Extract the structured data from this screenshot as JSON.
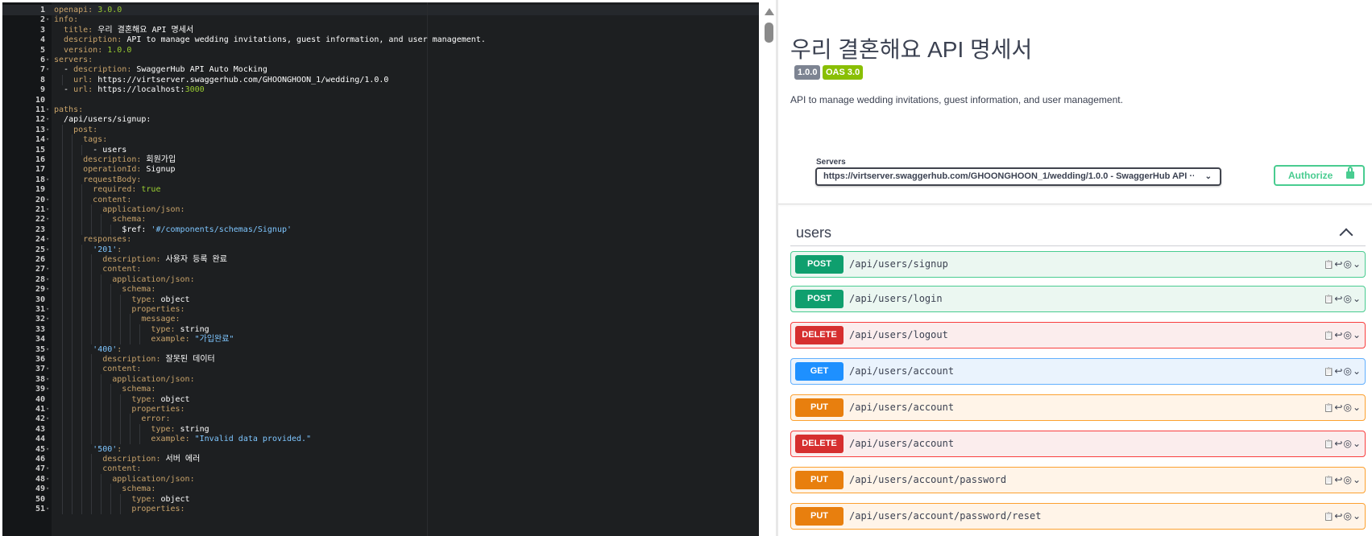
{
  "editor": {
    "lines": [
      [
        "1",
        [
          [
            "k",
            "openapi: "
          ],
          [
            "n",
            "3.0.0"
          ]
        ]
      ],
      [
        "2",
        [
          [
            "k",
            "info:"
          ]
        ]
      ],
      [
        "3",
        [
          [
            "p",
            "  "
          ],
          [
            "k",
            "title: "
          ],
          [
            "s",
            "우리 결혼해요 API 명세서"
          ]
        ]
      ],
      [
        "4",
        [
          [
            "p",
            "  "
          ],
          [
            "k",
            "description: "
          ],
          [
            "s",
            "API to manage wedding invitations, guest information, and user management."
          ]
        ]
      ],
      [
        "5",
        [
          [
            "p",
            "  "
          ],
          [
            "k",
            "version: "
          ],
          [
            "n",
            "1.0.0"
          ]
        ]
      ],
      [
        "6",
        [
          [
            "k",
            "servers:"
          ]
        ]
      ],
      [
        "7",
        [
          [
            "p",
            "  - "
          ],
          [
            "k",
            "description: "
          ],
          [
            "s",
            "SwaggerHub API Auto Mocking"
          ]
        ]
      ],
      [
        "8",
        [
          [
            "p",
            "    "
          ],
          [
            "k",
            "url: "
          ],
          [
            "s",
            "https://virtserver.swaggerhub.com/GHOONGHOON_1/wedding/1.0.0"
          ]
        ]
      ],
      [
        "9",
        [
          [
            "p",
            "  - "
          ],
          [
            "k",
            "url: "
          ],
          [
            "s",
            "https://localhost:"
          ],
          [
            "n",
            "3000"
          ]
        ]
      ],
      [
        "10",
        []
      ],
      [
        "11",
        [
          [
            "k",
            "paths:"
          ]
        ]
      ],
      [
        "12",
        [
          [
            "p",
            "  "
          ],
          [
            "s",
            "/api/users/signup:"
          ]
        ]
      ],
      [
        "13",
        [
          [
            "p",
            "    "
          ],
          [
            "k",
            "post:"
          ]
        ]
      ],
      [
        "14",
        [
          [
            "p",
            "      "
          ],
          [
            "k",
            "tags:"
          ]
        ]
      ],
      [
        "15",
        [
          [
            "p",
            "        - "
          ],
          [
            "s",
            "users"
          ]
        ]
      ],
      [
        "16",
        [
          [
            "p",
            "      "
          ],
          [
            "k",
            "description: "
          ],
          [
            "s",
            "회원가입"
          ]
        ]
      ],
      [
        "17",
        [
          [
            "p",
            "      "
          ],
          [
            "k",
            "operationId: "
          ],
          [
            "s",
            "Signup"
          ]
        ]
      ],
      [
        "18",
        [
          [
            "p",
            "      "
          ],
          [
            "k",
            "requestBody:"
          ]
        ]
      ],
      [
        "19",
        [
          [
            "p",
            "        "
          ],
          [
            "k",
            "required: "
          ],
          [
            "n",
            "true"
          ]
        ]
      ],
      [
        "20",
        [
          [
            "p",
            "        "
          ],
          [
            "k",
            "content:"
          ]
        ]
      ],
      [
        "21",
        [
          [
            "p",
            "          "
          ],
          [
            "k",
            "application/json:"
          ]
        ]
      ],
      [
        "22",
        [
          [
            "p",
            "            "
          ],
          [
            "k",
            "schema:"
          ]
        ]
      ],
      [
        "23",
        [
          [
            "p",
            "              "
          ],
          [
            "s",
            "$ref: "
          ],
          [
            "q",
            "'#/components/schemas/Signup'"
          ]
        ]
      ],
      [
        "24",
        [
          [
            "p",
            "      "
          ],
          [
            "k",
            "responses:"
          ]
        ]
      ],
      [
        "25",
        [
          [
            "p",
            "        "
          ],
          [
            "q",
            "'201'"
          ],
          [
            "k",
            ":"
          ]
        ]
      ],
      [
        "26",
        [
          [
            "p",
            "          "
          ],
          [
            "k",
            "description: "
          ],
          [
            "s",
            "사용자 등록 완료"
          ]
        ]
      ],
      [
        "27",
        [
          [
            "p",
            "          "
          ],
          [
            "k",
            "content:"
          ]
        ]
      ],
      [
        "28",
        [
          [
            "p",
            "            "
          ],
          [
            "k",
            "application/json:"
          ]
        ]
      ],
      [
        "29",
        [
          [
            "p",
            "              "
          ],
          [
            "k",
            "schema:"
          ]
        ]
      ],
      [
        "30",
        [
          [
            "p",
            "                "
          ],
          [
            "k",
            "type: "
          ],
          [
            "s",
            "object"
          ]
        ]
      ],
      [
        "31",
        [
          [
            "p",
            "                "
          ],
          [
            "k",
            "properties:"
          ]
        ]
      ],
      [
        "32",
        [
          [
            "p",
            "                  "
          ],
          [
            "k",
            "message:"
          ]
        ]
      ],
      [
        "33",
        [
          [
            "p",
            "                    "
          ],
          [
            "k",
            "type: "
          ],
          [
            "s",
            "string"
          ]
        ]
      ],
      [
        "34",
        [
          [
            "p",
            "                    "
          ],
          [
            "k",
            "example: "
          ],
          [
            "q",
            "\"가입완료\""
          ]
        ]
      ],
      [
        "35",
        [
          [
            "p",
            "        "
          ],
          [
            "q",
            "'400'"
          ],
          [
            "k",
            ":"
          ]
        ]
      ],
      [
        "36",
        [
          [
            "p",
            "          "
          ],
          [
            "k",
            "description: "
          ],
          [
            "s",
            "잘못된 데이터"
          ]
        ]
      ],
      [
        "37",
        [
          [
            "p",
            "          "
          ],
          [
            "k",
            "content:"
          ]
        ]
      ],
      [
        "38",
        [
          [
            "p",
            "            "
          ],
          [
            "k",
            "application/json:"
          ]
        ]
      ],
      [
        "39",
        [
          [
            "p",
            "              "
          ],
          [
            "k",
            "schema:"
          ]
        ]
      ],
      [
        "40",
        [
          [
            "p",
            "                "
          ],
          [
            "k",
            "type: "
          ],
          [
            "s",
            "object"
          ]
        ]
      ],
      [
        "41",
        [
          [
            "p",
            "                "
          ],
          [
            "k",
            "properties:"
          ]
        ]
      ],
      [
        "42",
        [
          [
            "p",
            "                  "
          ],
          [
            "k",
            "error:"
          ]
        ]
      ],
      [
        "43",
        [
          [
            "p",
            "                    "
          ],
          [
            "k",
            "type: "
          ],
          [
            "s",
            "string"
          ]
        ]
      ],
      [
        "44",
        [
          [
            "p",
            "                    "
          ],
          [
            "k",
            "example: "
          ],
          [
            "q",
            "\"Invalid data provided.\""
          ]
        ]
      ],
      [
        "45",
        [
          [
            "p",
            "        "
          ],
          [
            "q",
            "'500'"
          ],
          [
            "k",
            ":"
          ]
        ]
      ],
      [
        "46",
        [
          [
            "p",
            "          "
          ],
          [
            "k",
            "description: "
          ],
          [
            "s",
            "서버 에러"
          ]
        ]
      ],
      [
        "47",
        [
          [
            "p",
            "          "
          ],
          [
            "k",
            "content:"
          ]
        ]
      ],
      [
        "48",
        [
          [
            "p",
            "            "
          ],
          [
            "k",
            "application/json:"
          ]
        ]
      ],
      [
        "49",
        [
          [
            "p",
            "              "
          ],
          [
            "k",
            "schema:"
          ]
        ]
      ],
      [
        "50",
        [
          [
            "p",
            "                "
          ],
          [
            "k",
            "type: "
          ],
          [
            "s",
            "object"
          ]
        ]
      ],
      [
        "51",
        [
          [
            "p",
            "                "
          ],
          [
            "k",
            "properties:"
          ]
        ]
      ]
    ],
    "foldable": [
      "2",
      "6",
      "7",
      "11",
      "12",
      "13",
      "14",
      "18",
      "20",
      "21",
      "22",
      "24",
      "25",
      "27",
      "28",
      "29",
      "31",
      "32",
      "35",
      "37",
      "38",
      "39",
      "41",
      "42",
      "45",
      "47",
      "48",
      "49",
      "51"
    ]
  },
  "swagger": {
    "title": "우리 결혼해요 API 명세서",
    "version": "1.0.0",
    "oas": "OAS 3.0",
    "description": "API to manage wedding invitations, guest information, and user management.",
    "servers_label": "Servers",
    "server_selected": "https://virtserver.swaggerhub.com/GHOONGHOON_1/wedding/1.0.0 - SwaggerHub API ···",
    "authorize_label": "Authorize",
    "tag": "users",
    "operations": [
      {
        "method": "POST",
        "path": "/api/users/signup"
      },
      {
        "method": "POST",
        "path": "/api/users/login"
      },
      {
        "method": "DELETE",
        "path": "/api/users/logout"
      },
      {
        "method": "GET",
        "path": "/api/users/account"
      },
      {
        "method": "PUT",
        "path": "/api/users/account"
      },
      {
        "method": "DELETE",
        "path": "/api/users/account"
      },
      {
        "method": "PUT",
        "path": "/api/users/account/password"
      },
      {
        "method": "PUT",
        "path": "/api/users/account/password/reset"
      }
    ]
  }
}
